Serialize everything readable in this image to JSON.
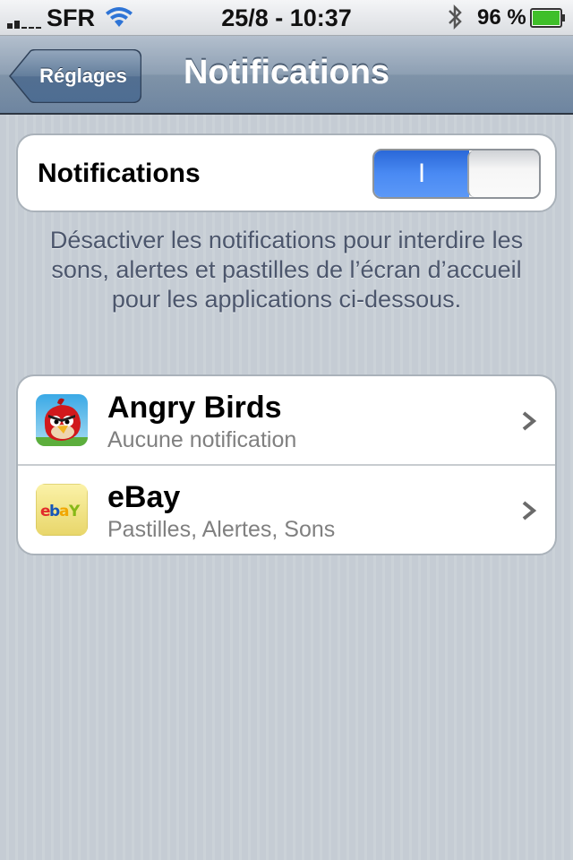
{
  "status_bar": {
    "carrier": "SFR",
    "time": "25/8 - 10:37",
    "battery_percent": "96 %",
    "battery_level": 0.96,
    "icons": [
      "signal-icon",
      "wifi-icon",
      "bluetooth-icon",
      "battery-icon"
    ]
  },
  "nav": {
    "back_label": "Réglages",
    "title": "Notifications"
  },
  "notifications": {
    "label": "Notifications",
    "toggle_state": "on",
    "toggle_on_text": "I"
  },
  "description": "Désactiver les notifications pour interdire les sons, alertes et pastilles de l’écran d’accueil pour les applications ci-dessous.",
  "apps": [
    {
      "name": "Angry Birds",
      "subtitle": "Aucune notification",
      "icon": "angry-birds-icon"
    },
    {
      "name": "eBay",
      "subtitle": "Pastilles, Alertes, Sons",
      "icon": "ebay-icon"
    }
  ],
  "colors": {
    "toggle_blue": "#4a8af3",
    "nav_bar": "#8d9fb3",
    "background": "#c5ccd4"
  }
}
